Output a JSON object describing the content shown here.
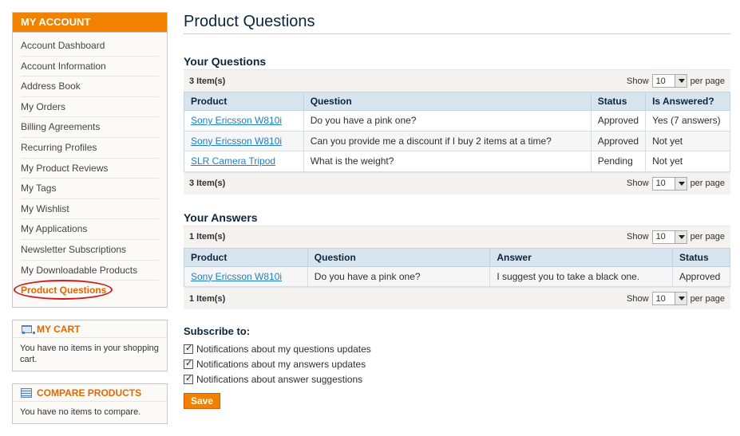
{
  "sidebar": {
    "account_title": "MY ACCOUNT",
    "items": [
      {
        "label": "Account Dashboard"
      },
      {
        "label": "Account Information"
      },
      {
        "label": "Address Book"
      },
      {
        "label": "My Orders"
      },
      {
        "label": "Billing Agreements"
      },
      {
        "label": "Recurring Profiles"
      },
      {
        "label": "My Product Reviews"
      },
      {
        "label": "My Tags"
      },
      {
        "label": "My Wishlist"
      },
      {
        "label": "My Applications"
      },
      {
        "label": "Newsletter Subscriptions"
      },
      {
        "label": "My Downloadable Products"
      },
      {
        "label": "Product Questions",
        "current": true
      }
    ],
    "cart": {
      "title": "MY CART",
      "text": "You have no items in your shopping cart."
    },
    "compare": {
      "title": "COMPARE PRODUCTS",
      "text": "You have no items to compare."
    }
  },
  "main": {
    "title": "Product Questions",
    "questions": {
      "heading": "Your Questions",
      "count": "3 Item(s)",
      "show": "Show",
      "limit": "10",
      "per_page": "per page",
      "columns": [
        "Product",
        "Question",
        "Status",
        "Is Answered?"
      ],
      "rows": [
        {
          "product": "Sony Ericsson W810i",
          "question": "Do you have a pink one?",
          "status": "Approved",
          "answered": "Yes (7 answers)"
        },
        {
          "product": "Sony Ericsson W810i",
          "question": "Can you provide me a discount if I buy 2 items at a time?",
          "status": "Approved",
          "answered": "Not yet"
        },
        {
          "product": "SLR Camera Tripod",
          "question": "What is the weight?",
          "status": "Pending",
          "answered": "Not yet"
        }
      ]
    },
    "answers": {
      "heading": "Your Answers",
      "count": "1 Item(s)",
      "show": "Show",
      "limit": "10",
      "per_page": "per page",
      "columns": [
        "Product",
        "Question",
        "Answer",
        "Status"
      ],
      "rows": [
        {
          "product": "Sony Ericsson W810i",
          "question": "Do you have a pink one?",
          "answer": "I suggest you to take a black one.",
          "status": "Approved"
        }
      ]
    },
    "subscribe": {
      "heading": "Subscribe to:",
      "options": [
        {
          "label": "Notifications about my questions updates",
          "checked": true
        },
        {
          "label": "Notifications about my answers updates",
          "checked": true
        },
        {
          "label": "Notifications about answer suggestions",
          "checked": true
        }
      ],
      "save_label": "Save"
    }
  },
  "colors": {
    "accent": "#f18200",
    "link": "#1e7ec8",
    "highlight_ring": "#d11c1c"
  }
}
